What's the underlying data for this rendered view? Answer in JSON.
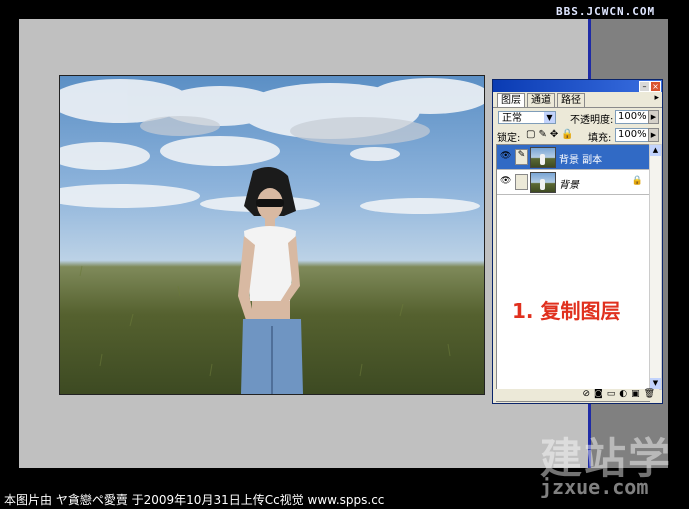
{
  "site_watermark": "BBS.JCWCN.COM",
  "panel": {
    "tabs": [
      "图层",
      "通道",
      "路径"
    ],
    "menu_arrow": "▸",
    "blend_mode": "正常",
    "opacity_label": "不透明度:",
    "opacity_value": "100%",
    "lock_label": "锁定:",
    "fill_label": "填充:",
    "fill_value": "100%",
    "layers": [
      {
        "name": "背景 副本",
        "selected": true
      },
      {
        "name": "背景",
        "selected": false
      }
    ],
    "annotation": "1. 复制图层"
  },
  "bottom_watermark": {
    "big": "建站学",
    "url": "jzxue.com"
  },
  "caption": "本图片由 ヤ貪戀ペ愛賣 于2009年10月31日上传Cc视觉 www.spps.cc",
  "colors": {
    "selection": "#316ac5",
    "annotation": "#e0301e",
    "canvas": "#c0c0c0"
  }
}
